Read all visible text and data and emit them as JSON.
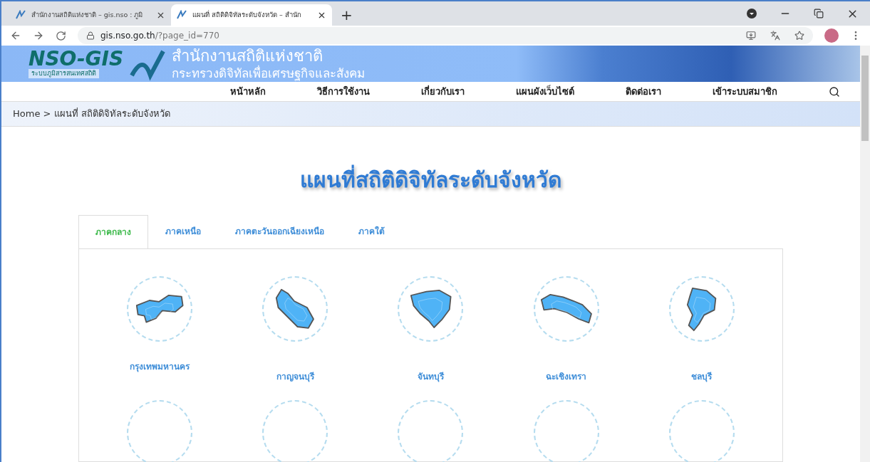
{
  "browser": {
    "tabs": [
      {
        "title": "สำนักงานสถิติแห่งชาติ – gis.nso : ภูมิ",
        "selected": false
      },
      {
        "title": "แผนที่ สถิติดิจิทัลระดับจังหวัด – สำนัก",
        "selected": true
      }
    ],
    "new_tab": "+",
    "url_host": "gis.nso.go.th",
    "url_path": "/?page_id=770"
  },
  "site": {
    "logo_text": "NSO-GIS",
    "logo_subtitle": "ระบบภูมิสารสนเทศสถิติ",
    "org_name": "สำนักงานสถิติแห่งชาติ",
    "ministry": "กระทรวงดิจิทัลเพื่อเศรษฐกิจและสังคม"
  },
  "nav": [
    "หน้าหลัก",
    "วิธีการใช้งาน",
    "เกี่ยวกับเรา",
    "แผนผังเว็บไซต์",
    "ติดต่อเรา",
    "เข้าระบบสมาชิก"
  ],
  "breadcrumb": "Home > แผนที่ สถิติดิจิทัลระดับจังหวัด",
  "page_title": "แผนที่สถิติดิจิทัลระดับจังหวัด",
  "region_tabs": [
    {
      "label": "ภาคกลาง",
      "selected": true
    },
    {
      "label": "ภาคเหนือ",
      "selected": false
    },
    {
      "label": "ภาคตะวันออกเฉียงเหนือ",
      "selected": false
    },
    {
      "label": "ภาคใต้",
      "selected": false
    }
  ],
  "provinces": [
    {
      "name": "กรุงเทพมหานคร"
    },
    {
      "name": "กาญจนบุรี"
    },
    {
      "name": "จันทบุรี"
    },
    {
      "name": "ฉะเชิงเทรา"
    },
    {
      "name": "ชลบุรี"
    }
  ]
}
